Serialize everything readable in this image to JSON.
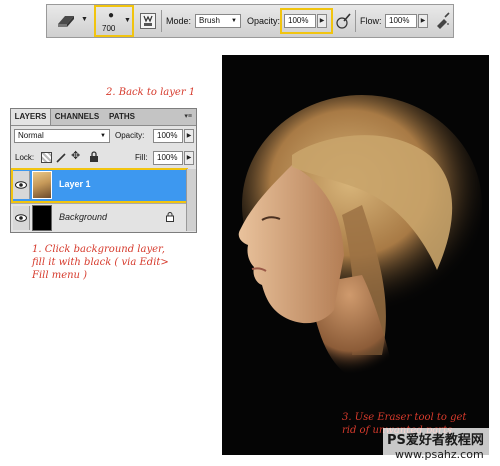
{
  "toolbar": {
    "brush_size": "700",
    "mode_label": "Mode:",
    "mode_value": "Brush",
    "opacity_label": "Opacity:",
    "opacity_value": "100%",
    "flow_label": "Flow:",
    "flow_value": "100%",
    "icons": [
      "eraser-icon",
      "brush-preset-icon",
      "brush-panel-icon",
      "pressure-opacity-icon",
      "airbrush-icon"
    ]
  },
  "layers_panel": {
    "tabs": [
      "LAYERS",
      "CHANNELS",
      "PATHS"
    ],
    "blend_mode": "Normal",
    "opacity_label": "Opacity:",
    "opacity_value": "100%",
    "lock_label": "Lock:",
    "fill_label": "Fill:",
    "fill_value": "100%",
    "layers": [
      {
        "name": "Layer 1",
        "selected": true
      },
      {
        "name": "Background",
        "selected": false
      }
    ]
  },
  "annotations": {
    "step2": "2. Back to layer 1",
    "step1_line1": "1. Click background layer,",
    "step1_line2": "fill it with black ( via Edit>",
    "step1_line3": "Fill menu )",
    "step3_line1": "3. Use Eraser tool to get",
    "step3_line2": "rid of unwanted parts"
  },
  "watermark": {
    "line1": "PS爱好者教程网",
    "line2": "www.psahz.com"
  },
  "colors": {
    "accent_highlight": "#f1c40f",
    "selected_layer": "#3d98f0",
    "annotation_text": "#d63a2c"
  }
}
